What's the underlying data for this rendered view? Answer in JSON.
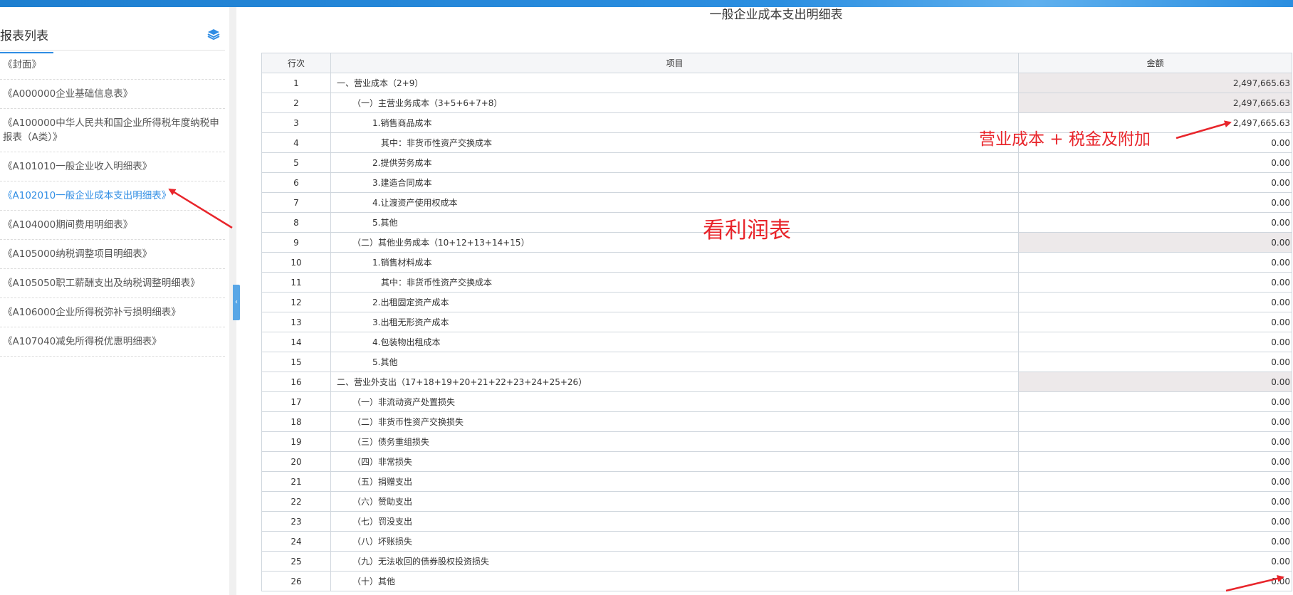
{
  "page_title": "一般企业成本支出明细表",
  "sidebar": {
    "title": "报表列表",
    "layers_icon": "layers-icon",
    "items": [
      {
        "label": "《封面》",
        "active": false
      },
      {
        "label": "《A000000企业基础信息表》",
        "active": false
      },
      {
        "label": "《A100000中华人民共和国企业所得税年度纳税申报表（A类）》",
        "active": false
      },
      {
        "label": "《A101010一般企业收入明细表》",
        "active": false
      },
      {
        "label": "《A102010一般企业成本支出明细表》",
        "active": true
      },
      {
        "label": "《A104000期间费用明细表》",
        "active": false
      },
      {
        "label": "《A105000纳税调整项目明细表》",
        "active": false
      },
      {
        "label": "《A105050职工薪酬支出及纳税调整明细表》",
        "active": false
      },
      {
        "label": "《A106000企业所得税弥补亏损明细表》",
        "active": false
      },
      {
        "label": "《A107040减免所得税优惠明细表》",
        "active": false
      }
    ]
  },
  "table": {
    "headers": {
      "row": "行次",
      "item": "项目",
      "amount": "金额"
    },
    "rows": [
      {
        "no": "1",
        "item": "一、营业成本（2+9）",
        "amount": "2,497,665.63",
        "indent": 0,
        "shaded": true
      },
      {
        "no": "2",
        "item": "（一）主营业务成本（3+5+6+7+8）",
        "amount": "2,497,665.63",
        "indent": 1,
        "shaded": true
      },
      {
        "no": "3",
        "item": "1.销售商品成本",
        "amount": "2,497,665.63",
        "indent": 2,
        "shaded": false
      },
      {
        "no": "4",
        "item": "其中：非货币性资产交换成本",
        "amount": "0.00",
        "indent": 3,
        "shaded": false
      },
      {
        "no": "5",
        "item": "2.提供劳务成本",
        "amount": "0.00",
        "indent": 2,
        "shaded": false
      },
      {
        "no": "6",
        "item": "3.建造合同成本",
        "amount": "0.00",
        "indent": 2,
        "shaded": false
      },
      {
        "no": "7",
        "item": "4.让渡资产使用权成本",
        "amount": "0.00",
        "indent": 2,
        "shaded": false
      },
      {
        "no": "8",
        "item": "5.其他",
        "amount": "0.00",
        "indent": 2,
        "shaded": false
      },
      {
        "no": "9",
        "item": "（二）其他业务成本（10+12+13+14+15）",
        "amount": "0.00",
        "indent": 1,
        "shaded": true
      },
      {
        "no": "10",
        "item": "1.销售材料成本",
        "amount": "0.00",
        "indent": 2,
        "shaded": false
      },
      {
        "no": "11",
        "item": "其中：非货币性资产交换成本",
        "amount": "0.00",
        "indent": 3,
        "shaded": false
      },
      {
        "no": "12",
        "item": "2.出租固定资产成本",
        "amount": "0.00",
        "indent": 2,
        "shaded": false
      },
      {
        "no": "13",
        "item": "3.出租无形资产成本",
        "amount": "0.00",
        "indent": 2,
        "shaded": false
      },
      {
        "no": "14",
        "item": "4.包装物出租成本",
        "amount": "0.00",
        "indent": 2,
        "shaded": false
      },
      {
        "no": "15",
        "item": "5.其他",
        "amount": "0.00",
        "indent": 2,
        "shaded": false
      },
      {
        "no": "16",
        "item": "二、营业外支出（17+18+19+20+21+22+23+24+25+26）",
        "amount": "0.00",
        "indent": 0,
        "shaded": true
      },
      {
        "no": "17",
        "item": "（一）非流动资产处置损失",
        "amount": "0.00",
        "indent": 1,
        "shaded": false
      },
      {
        "no": "18",
        "item": "（二）非货币性资产交换损失",
        "amount": "0.00",
        "indent": 1,
        "shaded": false
      },
      {
        "no": "19",
        "item": "（三）债务重组损失",
        "amount": "0.00",
        "indent": 1,
        "shaded": false
      },
      {
        "no": "20",
        "item": "（四）非常损失",
        "amount": "0.00",
        "indent": 1,
        "shaded": false
      },
      {
        "no": "21",
        "item": "（五）捐赠支出",
        "amount": "0.00",
        "indent": 1,
        "shaded": false
      },
      {
        "no": "22",
        "item": "（六）赞助支出",
        "amount": "0.00",
        "indent": 1,
        "shaded": false
      },
      {
        "no": "23",
        "item": "（七）罚没支出",
        "amount": "0.00",
        "indent": 1,
        "shaded": false
      },
      {
        "no": "24",
        "item": "（八）坏账损失",
        "amount": "0.00",
        "indent": 1,
        "shaded": false
      },
      {
        "no": "25",
        "item": "（九）无法收回的债券股权投资损失",
        "amount": "0.00",
        "indent": 1,
        "shaded": false
      },
      {
        "no": "26",
        "item": "（十）其他",
        "amount": "0.00",
        "indent": 1,
        "shaded": false
      }
    ]
  },
  "annotations": {
    "cost_note": "营业成本 + 税金及附加",
    "profit_note": "看利润表",
    "color": "#e8252b"
  }
}
